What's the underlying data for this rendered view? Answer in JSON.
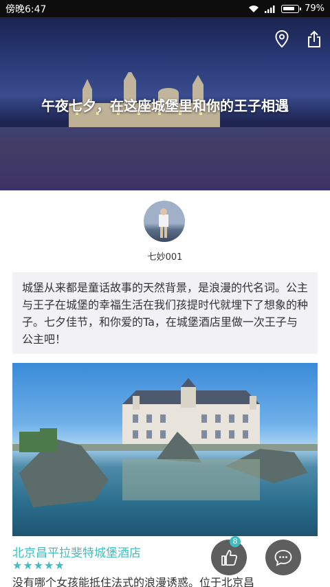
{
  "status_bar": {
    "time": "傍晚6:47",
    "battery": "79%"
  },
  "hero": {
    "title": "午夜七夕，在这座城堡里和你的王子相遇",
    "location_icon": "location-pin-icon",
    "share_icon": "share-icon"
  },
  "author": {
    "name": "七妙001"
  },
  "intro": {
    "text": "城堡从来都是童话故事的天然背景，是浪漫的代名词。公主与王子在城堡的幸福生活在我们孩提时代就埋下了想象的种子。七夕佳节，和你爱的Ta，在城堡酒店里做一次王子与公主吧！"
  },
  "hotel": {
    "name": "北京昌平拉斐特城堡酒店",
    "rating": 5,
    "stars": "★★★★★",
    "description": "没有哪个女孩能抵住法式的浪漫诱惑。位于北京昌"
  },
  "actions": {
    "like_count": "8",
    "like_icon": "thumbs-up-icon",
    "comment_icon": "comment-icon"
  },
  "colors": {
    "accent": "#3ebec0",
    "status_bar": "#0d0d0d",
    "fab": "#5e5e5e",
    "intro_bg": "#f2f2f4"
  }
}
